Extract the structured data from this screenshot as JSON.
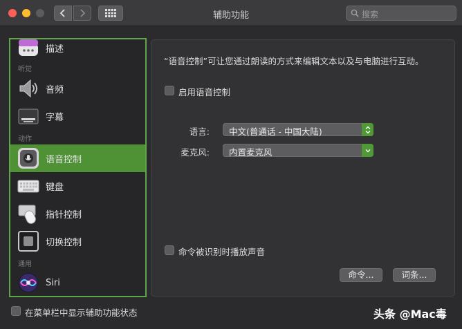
{
  "window": {
    "title": "辅助功能"
  },
  "search": {
    "placeholder": "搜索"
  },
  "sidebar": {
    "items": [
      {
        "label": "描述"
      },
      {
        "label": "音频"
      },
      {
        "label": "字幕"
      },
      {
        "label": "语音控制"
      },
      {
        "label": "键盘"
      },
      {
        "label": "指针控制"
      },
      {
        "label": "切换控制"
      },
      {
        "label": "Siri"
      }
    ],
    "sections": {
      "hearing": "听觉",
      "motor": "动作",
      "general": "通用"
    },
    "selected": "语音控制"
  },
  "panel": {
    "description": "“语音控制”可让您通过朗读的方式来编辑文本以及与电脑进行互动。",
    "enable_label": "启用语音控制",
    "language_label": "语言:",
    "language_value": "中文(普通话 - 中国大陆)",
    "mic_label": "麦克风:",
    "mic_value": "内置麦克风",
    "play_sound_label": "命令被识别时播放声音",
    "commands_button": "命令...",
    "vocabulary_button": "词条..."
  },
  "footer": {
    "menubar_label": "在菜单栏中显示辅助功能状态"
  },
  "watermark": "头条 @Mac毒",
  "colors": {
    "accent": "#4f9135",
    "sidebar_border": "#5fa64a"
  }
}
